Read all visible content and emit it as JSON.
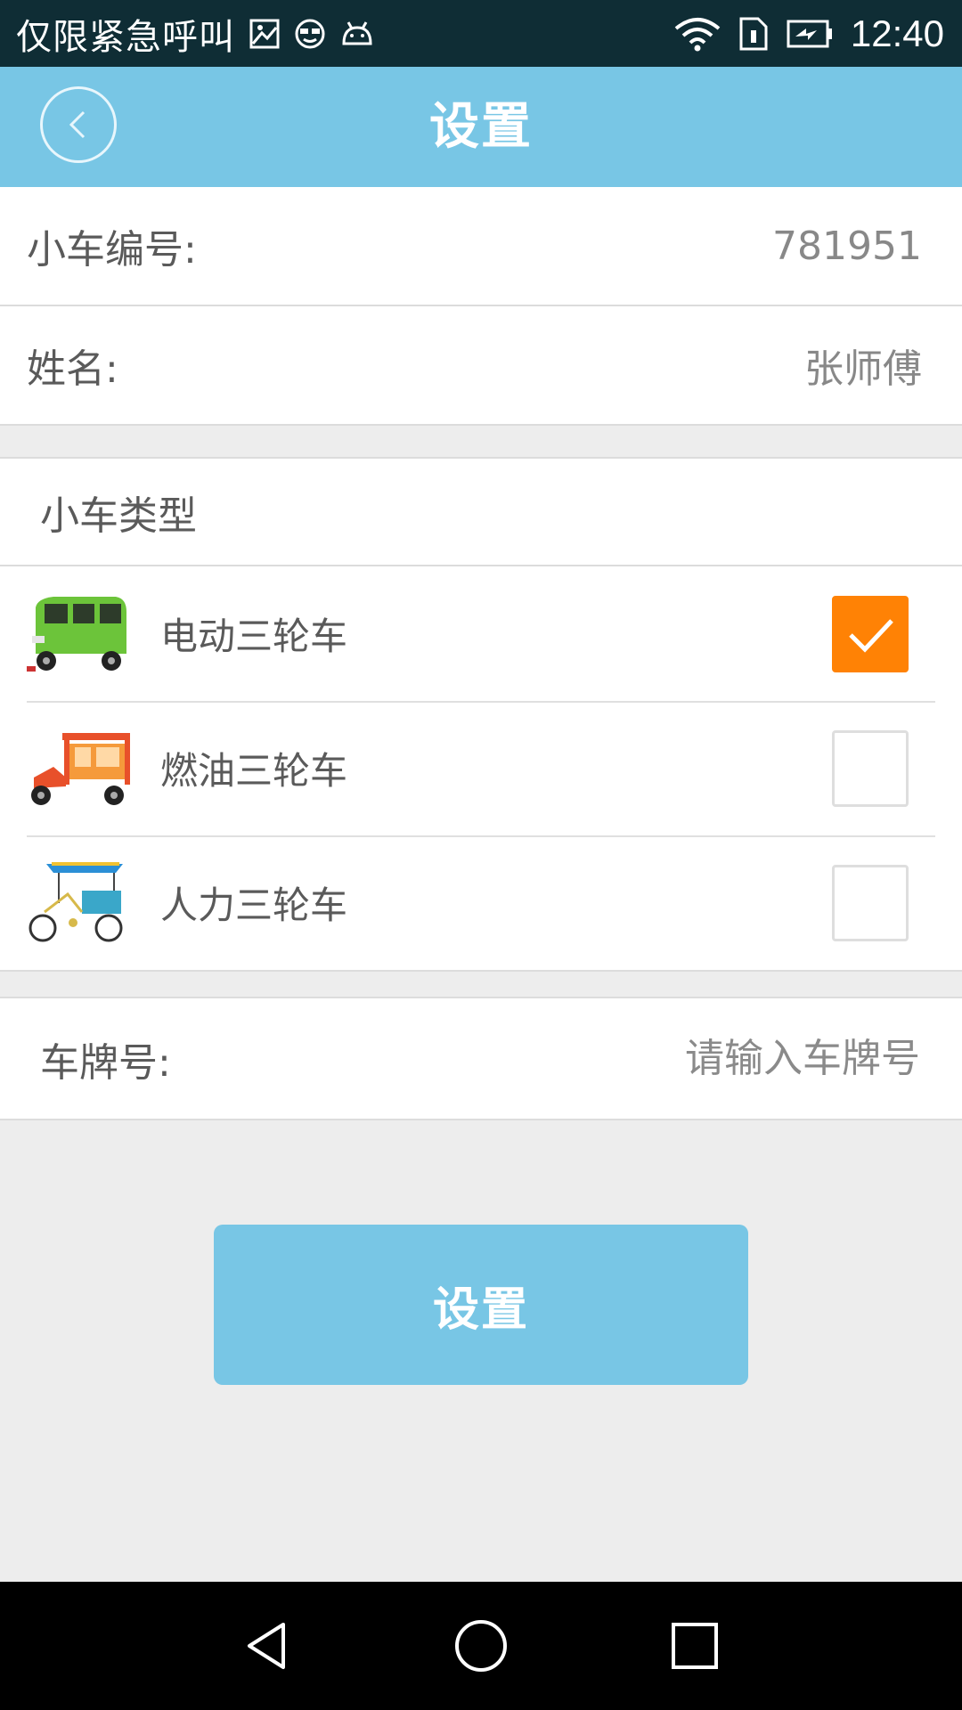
{
  "status_bar": {
    "carrier": "仅限紧急呼叫",
    "time": "12:40",
    "icons": [
      "image-icon",
      "sunglasses-face-icon",
      "android-icon",
      "wifi-icon",
      "sim-icon",
      "battery-charging-icon"
    ]
  },
  "header": {
    "title": "设置",
    "back_icon": "chevron-left-icon"
  },
  "info": {
    "car_number_label": "小车编号:",
    "car_number_value": "781951",
    "name_label": "姓名:",
    "name_value": "张师傅"
  },
  "vehicle_types": {
    "title": "小车类型",
    "options": [
      {
        "label": "电动三轮车",
        "checked": true,
        "icon": "electric-tricycle-image"
      },
      {
        "label": "燃油三轮车",
        "checked": false,
        "icon": "fuel-tricycle-image"
      },
      {
        "label": "人力三轮车",
        "checked": false,
        "icon": "pedal-tricycle-image"
      }
    ]
  },
  "plate": {
    "label": "车牌号:",
    "placeholder": "请输入车牌号"
  },
  "submit": {
    "label": "设置"
  },
  "colors": {
    "accent": "#78c6e5",
    "checked": "#ff8205"
  }
}
